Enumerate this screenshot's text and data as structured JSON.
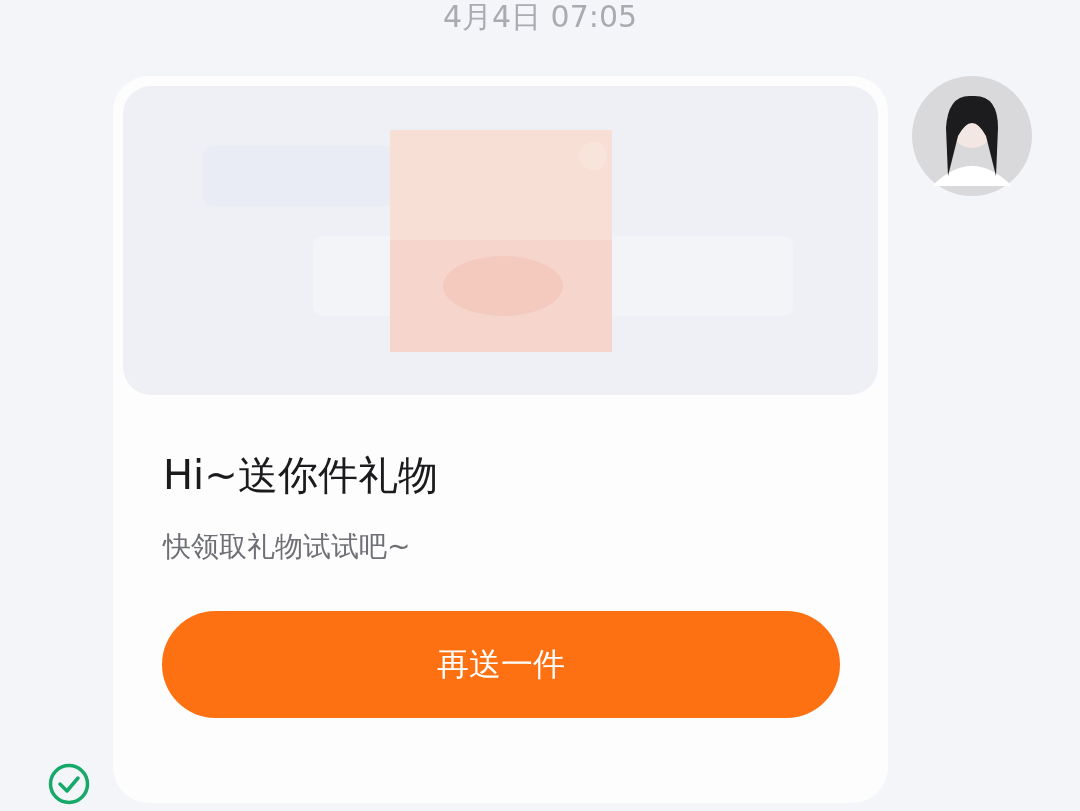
{
  "timestamp": "4月4日 07:05",
  "message": {
    "title": "Hi~送你件礼物",
    "subtitle": "快领取礼物试试吧~",
    "button": "再送一件",
    "delivered": true
  }
}
